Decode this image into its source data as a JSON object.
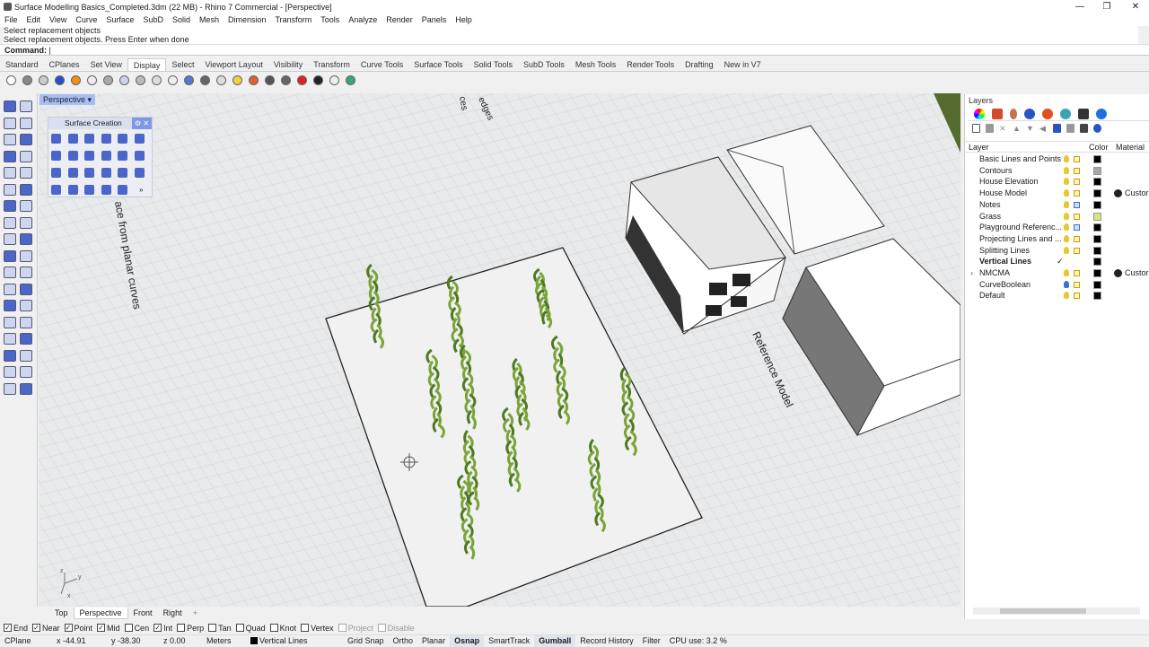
{
  "window": {
    "title": "Surface Modelling Basics_Completed.3dm (22 MB) - Rhino 7 Commercial - [Perspective]",
    "minimize": "—",
    "maximize": "❐",
    "close": "✕"
  },
  "menu": [
    "File",
    "Edit",
    "View",
    "Curve",
    "Surface",
    "SubD",
    "Solid",
    "Mesh",
    "Dimension",
    "Transform",
    "Tools",
    "Analyze",
    "Render",
    "Panels",
    "Help"
  ],
  "command": {
    "history": [
      "Select replacement objects",
      "Select replacement objects. Press Enter when done"
    ],
    "prompt": "Command:",
    "value": ""
  },
  "toolbar_tabs": {
    "items": [
      "Standard",
      "CPlanes",
      "Set View",
      "Display",
      "Select",
      "Viewport Layout",
      "Visibility",
      "Transform",
      "Curve Tools",
      "Surface Tools",
      "Solid Tools",
      "SubD Tools",
      "Mesh Tools",
      "Render Tools",
      "Drafting",
      "New in V7"
    ],
    "active": "Display"
  },
  "display_icons": [
    "wireframe",
    "shaded",
    "rendered-ghost",
    "rendered",
    "material-orange",
    "x-ray",
    "technical",
    "artistic",
    "pen",
    "flat-shade",
    "arctic",
    "set-camera",
    "lens",
    "sphere",
    "light-bulb",
    "section",
    "environment",
    "camera",
    "clear-x",
    "monitor",
    "isolate",
    "cubes"
  ],
  "viewport": {
    "name": "Perspective",
    "dropdown": "▾",
    "annotations": {
      "planar": "ace from planar curves",
      "reference": "Reference Model",
      "top_left": "ces",
      "top_right": "edges"
    },
    "axis": {
      "x": "x",
      "y": "y",
      "z": "z"
    }
  },
  "surface_creation": {
    "title": "Surface Creation",
    "more": "»"
  },
  "viewport_tabs": {
    "items": [
      "Top",
      "Perspective",
      "Front",
      "Right"
    ],
    "active": "Perspective",
    "add": "+"
  },
  "osnaps": [
    {
      "label": "End",
      "checked": true
    },
    {
      "label": "Near",
      "checked": true
    },
    {
      "label": "Point",
      "checked": true
    },
    {
      "label": "Mid",
      "checked": true
    },
    {
      "label": "Cen",
      "checked": false
    },
    {
      "label": "Int",
      "checked": true
    },
    {
      "label": "Perp",
      "checked": false
    },
    {
      "label": "Tan",
      "checked": false
    },
    {
      "label": "Quad",
      "checked": false
    },
    {
      "label": "Knot",
      "checked": false
    },
    {
      "label": "Vertex",
      "checked": false
    },
    {
      "label": "Project",
      "checked": false,
      "disabled": true
    },
    {
      "label": "Disable",
      "checked": false,
      "disabled": true
    }
  ],
  "status": {
    "cplane": "CPlane",
    "x": "x -44.91",
    "y": "y -38.30",
    "z": "z 0.00",
    "units": "Meters",
    "layer": "Vertical Lines",
    "grid_snap": "Grid Snap",
    "ortho": "Ortho",
    "planar": "Planar",
    "osnap": "Osnap",
    "smarttrack": "SmartTrack",
    "gumball": "Gumball",
    "record_history": "Record History",
    "filter": "Filter",
    "cpu": "CPU use: 3.2 %"
  },
  "layers_panel": {
    "title": "Layers",
    "headers": {
      "layer": "Layer",
      "color": "Color",
      "material": "Material"
    },
    "layers": [
      {
        "name": "Basic Lines and Points",
        "color": "#000000",
        "locked": false,
        "material": ""
      },
      {
        "name": "Contours",
        "color": "#a8a8a8",
        "locked": false,
        "material": ""
      },
      {
        "name": "House Elevation",
        "color": "#000000",
        "locked": false,
        "material": ""
      },
      {
        "name": "House Model",
        "color": "#000000",
        "locked": false,
        "material": "Custor"
      },
      {
        "name": "Notes",
        "color": "#000000",
        "locked": true,
        "material": ""
      },
      {
        "name": "Grass",
        "color": "#d4e87a",
        "locked": false,
        "material": ""
      },
      {
        "name": "Playground Referenc...",
        "color": "#000000",
        "locked": true,
        "material": ""
      },
      {
        "name": "Projecting Lines and ...",
        "color": "#000000",
        "locked": false,
        "material": ""
      },
      {
        "name": "Splitting Lines",
        "color": "#000000",
        "locked": false,
        "material": ""
      },
      {
        "name": "Vertical Lines",
        "color": "#000000",
        "current": true,
        "check": "✓",
        "material": ""
      },
      {
        "name": "NMCMA",
        "color": "#000000",
        "locked": false,
        "material": "Custor",
        "expander": "›"
      },
      {
        "name": "CurveBoolean",
        "color": "#000000",
        "locked": false,
        "material": "",
        "off": true
      },
      {
        "name": "Default",
        "color": "#000000",
        "locked": false,
        "material": ""
      }
    ]
  }
}
